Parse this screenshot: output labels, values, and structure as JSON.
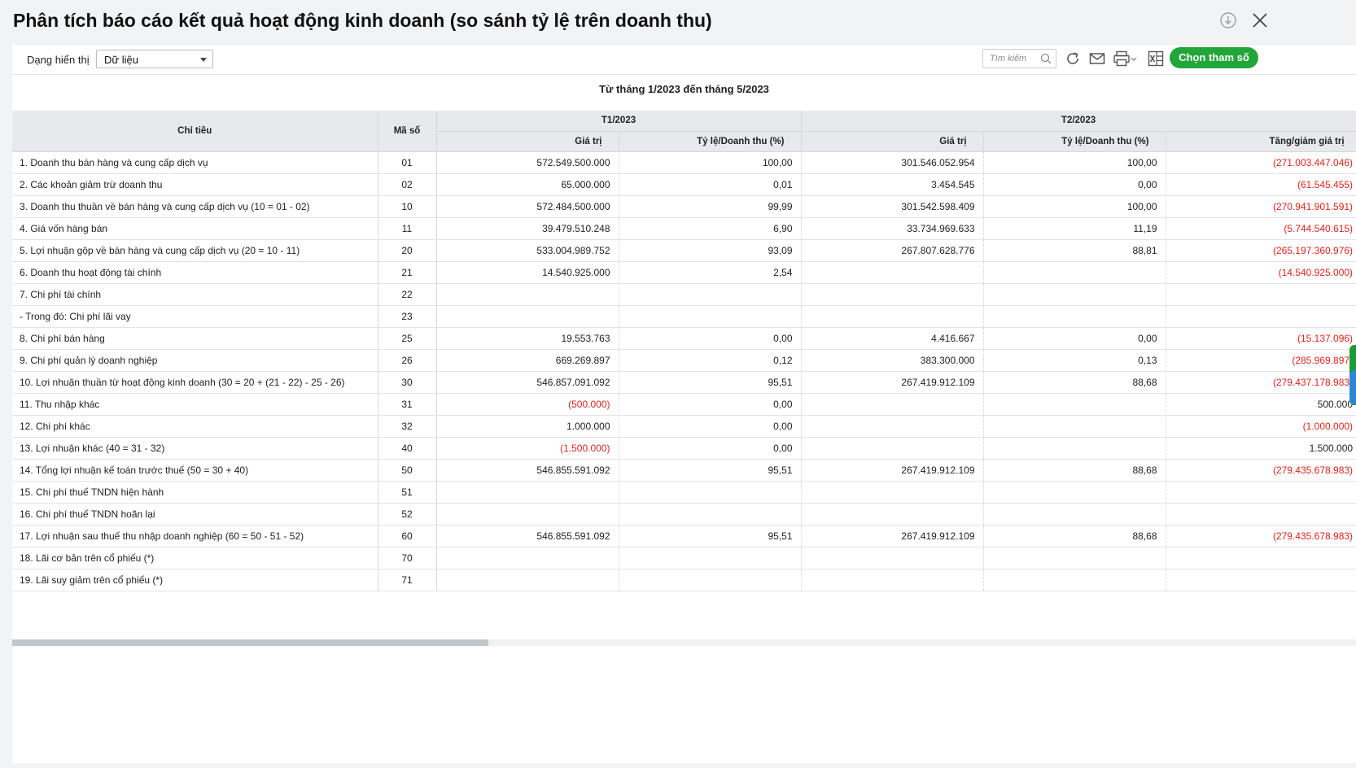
{
  "window": {
    "title": "Phân tích báo cáo kết quả hoạt động kinh doanh (so sánh tỷ lệ trên doanh thu)"
  },
  "toolbar": {
    "view_label": "Dạng hiển thị",
    "view_value": "Dữ liệu",
    "search_placeholder": "Tìm kiếm",
    "param_button": "Chọn tham số"
  },
  "report": {
    "period": "Từ tháng 1/2023 đến tháng 5/2023"
  },
  "table": {
    "headers": {
      "indicator": "Chỉ tiêu",
      "code": "Mã số",
      "p1": "T1/2023",
      "p2": "T2/2023",
      "value": "Giá trị",
      "ratio": "Tỷ lệ/Doanh thu (%)",
      "change": "Tăng/giảm giá trị"
    },
    "rows": [
      {
        "name": "1. Doanh thu bán hàng và cung cấp dịch vụ",
        "code": "01",
        "v1": "572.549.500.000",
        "r1": "100,00",
        "v2": "301.546.052.954",
        "r2": "100,00",
        "chg": "(271.003.447.046)"
      },
      {
        "name": "2. Các khoản giảm trừ doanh thu",
        "code": "02",
        "v1": "65.000.000",
        "r1": "0,01",
        "v2": "3.454.545",
        "r2": "0,00",
        "chg": "(61.545.455)"
      },
      {
        "name": "3. Doanh thu thuần về bán hàng và cung cấp dịch vụ (10 = 01 - 02)",
        "code": "10",
        "v1": "572.484.500.000",
        "r1": "99,99",
        "v2": "301.542.598.409",
        "r2": "100,00",
        "chg": "(270.941.901.591)"
      },
      {
        "name": "4. Giá vốn hàng bán",
        "code": "11",
        "v1": "39.479.510.248",
        "r1": "6,90",
        "v2": "33.734.969.633",
        "r2": "11,19",
        "chg": "(5.744.540.615)"
      },
      {
        "name": "5. Lợi nhuận gộp về bán hàng và cung cấp dịch vụ (20 = 10 - 11)",
        "code": "20",
        "v1": "533.004.989.752",
        "r1": "93,09",
        "v2": "267.807.628.776",
        "r2": "88,81",
        "chg": "(265.197.360.976)"
      },
      {
        "name": "6. Doanh thu hoạt động tài chính",
        "code": "21",
        "v1": "14.540.925.000",
        "r1": "2,54",
        "v2": "",
        "r2": "",
        "chg": "(14.540.925.000)"
      },
      {
        "name": "7. Chi phí tài chính",
        "code": "22",
        "v1": "",
        "r1": "",
        "v2": "",
        "r2": "",
        "chg": ""
      },
      {
        "name": "- Trong đó: Chi phí lãi vay",
        "code": "23",
        "v1": "",
        "r1": "",
        "v2": "",
        "r2": "",
        "chg": ""
      },
      {
        "name": "8. Chi phí bán hàng",
        "code": "25",
        "v1": "19.553.763",
        "r1": "0,00",
        "v2": "4.416.667",
        "r2": "0,00",
        "chg": "(15.137.096)"
      },
      {
        "name": "9. Chi phí quản lý doanh nghiệp",
        "code": "26",
        "v1": "669.269.897",
        "r1": "0,12",
        "v2": "383.300.000",
        "r2": "0,13",
        "chg": "(285.969.897)"
      },
      {
        "name": "10. Lợi nhuận thuần từ hoạt động kinh doanh (30 = 20 + (21 - 22) - 25 - 26)",
        "code": "30",
        "v1": "546.857.091.092",
        "r1": "95,51",
        "v2": "267.419.912.109",
        "r2": "88,68",
        "chg": "(279.437.178.983)"
      },
      {
        "name": "11. Thu nhập khác",
        "code": "31",
        "v1": "(500.000)",
        "r1": "0,00",
        "v2": "",
        "r2": "",
        "chg": "500.000"
      },
      {
        "name": "12. Chi phí khác",
        "code": "32",
        "v1": "1.000.000",
        "r1": "0,00",
        "v2": "",
        "r2": "",
        "chg": "(1.000.000)"
      },
      {
        "name": "13. Lợi nhuận khác (40 = 31 - 32)",
        "code": "40",
        "v1": "(1.500.000)",
        "r1": "0,00",
        "v2": "",
        "r2": "",
        "chg": "1.500.000"
      },
      {
        "name": "14. Tổng lợi nhuận kế toán trước thuế (50 = 30 + 40)",
        "code": "50",
        "v1": "546.855.591.092",
        "r1": "95,51",
        "v2": "267.419.912.109",
        "r2": "88,68",
        "chg": "(279.435.678.983)"
      },
      {
        "name": "15. Chi phí thuế TNDN hiện hành",
        "code": "51",
        "v1": "",
        "r1": "",
        "v2": "",
        "r2": "",
        "chg": ""
      },
      {
        "name": "16. Chi phí thuế TNDN hoãn lại",
        "code": "52",
        "v1": "",
        "r1": "",
        "v2": "",
        "r2": "",
        "chg": ""
      },
      {
        "name": "17. Lợi nhuận sau thuế thu nhập doanh nghiệp (60 = 50 - 51 - 52)",
        "code": "60",
        "v1": "546.855.591.092",
        "r1": "95,51",
        "v2": "267.419.912.109",
        "r2": "88,68",
        "chg": "(279.435.678.983)"
      },
      {
        "name": "18. Lãi cơ bản trên cổ phiếu (*)",
        "code": "70",
        "v1": "",
        "r1": "",
        "v2": "",
        "r2": "",
        "chg": ""
      },
      {
        "name": "19. Lãi suy giảm trên cổ phiếu (*)",
        "code": "71",
        "v1": "",
        "r1": "",
        "v2": "",
        "r2": "",
        "chg": ""
      }
    ]
  },
  "colors": {
    "accent_green": "#22a63a",
    "negative_red": "#e0241b",
    "header_gray": "#e8e9ec"
  },
  "icons": [
    "download-icon",
    "close-icon",
    "search-icon",
    "refresh-icon",
    "mail-icon",
    "print-icon",
    "excel-icon"
  ]
}
